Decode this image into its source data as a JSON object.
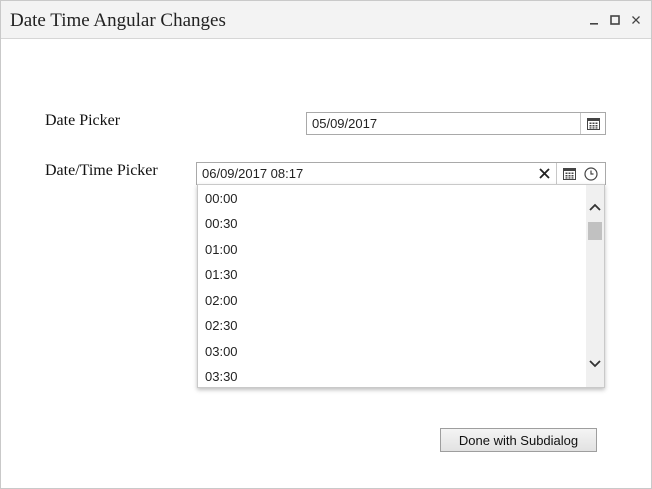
{
  "window": {
    "title": "Date Time Angular Changes",
    "controls": {
      "minimize": "minimize-icon",
      "maximize": "maximize-icon",
      "close": "close-icon"
    }
  },
  "date_picker": {
    "label": "Date Picker",
    "value": "05/09/2017",
    "icon": "calendar-icon"
  },
  "datetime_picker": {
    "label": "Date/Time Picker",
    "value": "06/09/2017 08:17",
    "icons": [
      "clear-icon",
      "calendar-icon",
      "clock-icon"
    ]
  },
  "time_dropdown": {
    "options": [
      "00:00",
      "00:30",
      "01:00",
      "01:30",
      "02:00",
      "02:30",
      "03:00",
      "03:30"
    ]
  },
  "footer": {
    "done_label": "Done with Subdialog"
  }
}
